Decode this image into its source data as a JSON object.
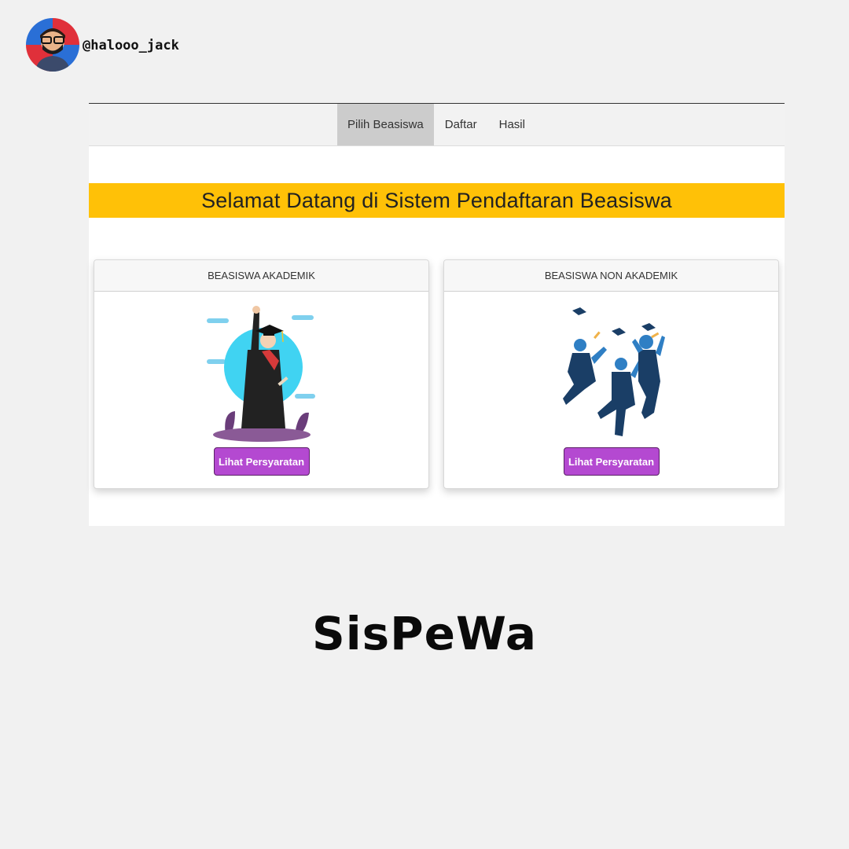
{
  "author": {
    "handle": "@halooo_jack",
    "avatar_icon": "avatar-icon"
  },
  "navbar": {
    "items": [
      {
        "label": "Pilih Beasiswa",
        "active": true
      },
      {
        "label": "Daftar",
        "active": false
      },
      {
        "label": "Hasil",
        "active": false
      }
    ]
  },
  "banner": {
    "title": "Selamat Datang di Sistem Pendaftaran Beasiswa",
    "color": "#ffc107"
  },
  "cards": [
    {
      "header": "BEASISWA AKADEMIK",
      "button_label": "Lihat Persyaratan",
      "illustration": "graduate-illustration"
    },
    {
      "header": "BEASISWA NON AKADEMIK",
      "button_label": "Lihat Persyaratan",
      "illustration": "celebrating-graduates-illustration"
    }
  ],
  "button_color": "#b449d1",
  "caption": "SisPeWa"
}
